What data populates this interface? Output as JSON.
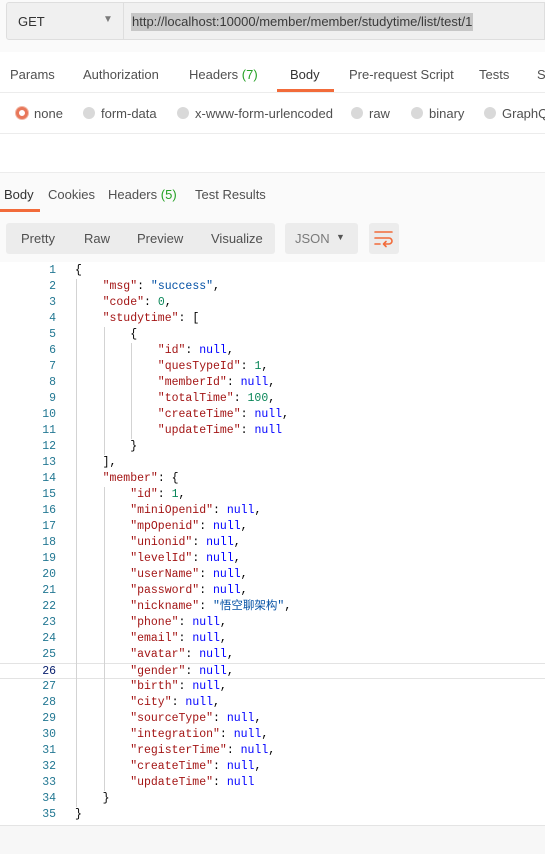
{
  "request": {
    "method": "GET",
    "url": "http://localhost:10000/member/member/studytime/list/test/1"
  },
  "request_tabs": [
    {
      "label": "Params",
      "count": ""
    },
    {
      "label": "Authorization",
      "count": ""
    },
    {
      "label": "Headers",
      "count": "(7)"
    },
    {
      "label": "Body",
      "count": "",
      "active": true
    },
    {
      "label": "Pre-request Script",
      "count": ""
    },
    {
      "label": "Tests",
      "count": ""
    },
    {
      "label": "S",
      "count": ""
    }
  ],
  "body_types": [
    {
      "label": "none",
      "selected": true
    },
    {
      "label": "form-data",
      "selected": false
    },
    {
      "label": "x-www-form-urlencoded",
      "selected": false
    },
    {
      "label": "raw",
      "selected": false
    },
    {
      "label": "binary",
      "selected": false
    },
    {
      "label": "GraphQ",
      "selected": false
    }
  ],
  "response_tabs": [
    {
      "label": "Body",
      "count": "",
      "active": true
    },
    {
      "label": "Cookies",
      "count": ""
    },
    {
      "label": "Headers",
      "count": "(5)"
    },
    {
      "label": "Test Results",
      "count": ""
    }
  ],
  "view_modes": [
    "Pretty",
    "Raw",
    "Preview",
    "Visualize"
  ],
  "format": "JSON",
  "icons": {
    "method_dropdown": "chevron-down-icon",
    "format_dropdown": "chevron-down-icon",
    "wrap": "wrap-lines-icon"
  },
  "colors": {
    "accent": "#f26b3a",
    "count_green": "#25a125",
    "json_key": "#a31515",
    "json_string": "#0451a5",
    "json_number": "#098658",
    "json_null": "#0000ff"
  },
  "current_line": 26,
  "code_lines": [
    "{",
    "    \"msg\": \"success\",",
    "    \"code\": 0,",
    "    \"studytime\": [",
    "        {",
    "            \"id\": null,",
    "            \"quesTypeId\": 1,",
    "            \"memberId\": null,",
    "            \"totalTime\": 100,",
    "            \"createTime\": null,",
    "            \"updateTime\": null",
    "        }",
    "    ],",
    "    \"member\": {",
    "        \"id\": 1,",
    "        \"miniOpenid\": null,",
    "        \"mpOpenid\": null,",
    "        \"unionid\": null,",
    "        \"levelId\": null,",
    "        \"userName\": null,",
    "        \"password\": null,",
    "        \"nickname\": \"悟空聊架构\",",
    "        \"phone\": null,",
    "        \"email\": null,",
    "        \"avatar\": null,",
    "        \"gender\": null,",
    "        \"birth\": null,",
    "        \"city\": null,",
    "        \"sourceType\": null,",
    "        \"integration\": null,",
    "        \"registerTime\": null,",
    "        \"createTime\": null,",
    "        \"updateTime\": null",
    "    }",
    "}"
  ]
}
